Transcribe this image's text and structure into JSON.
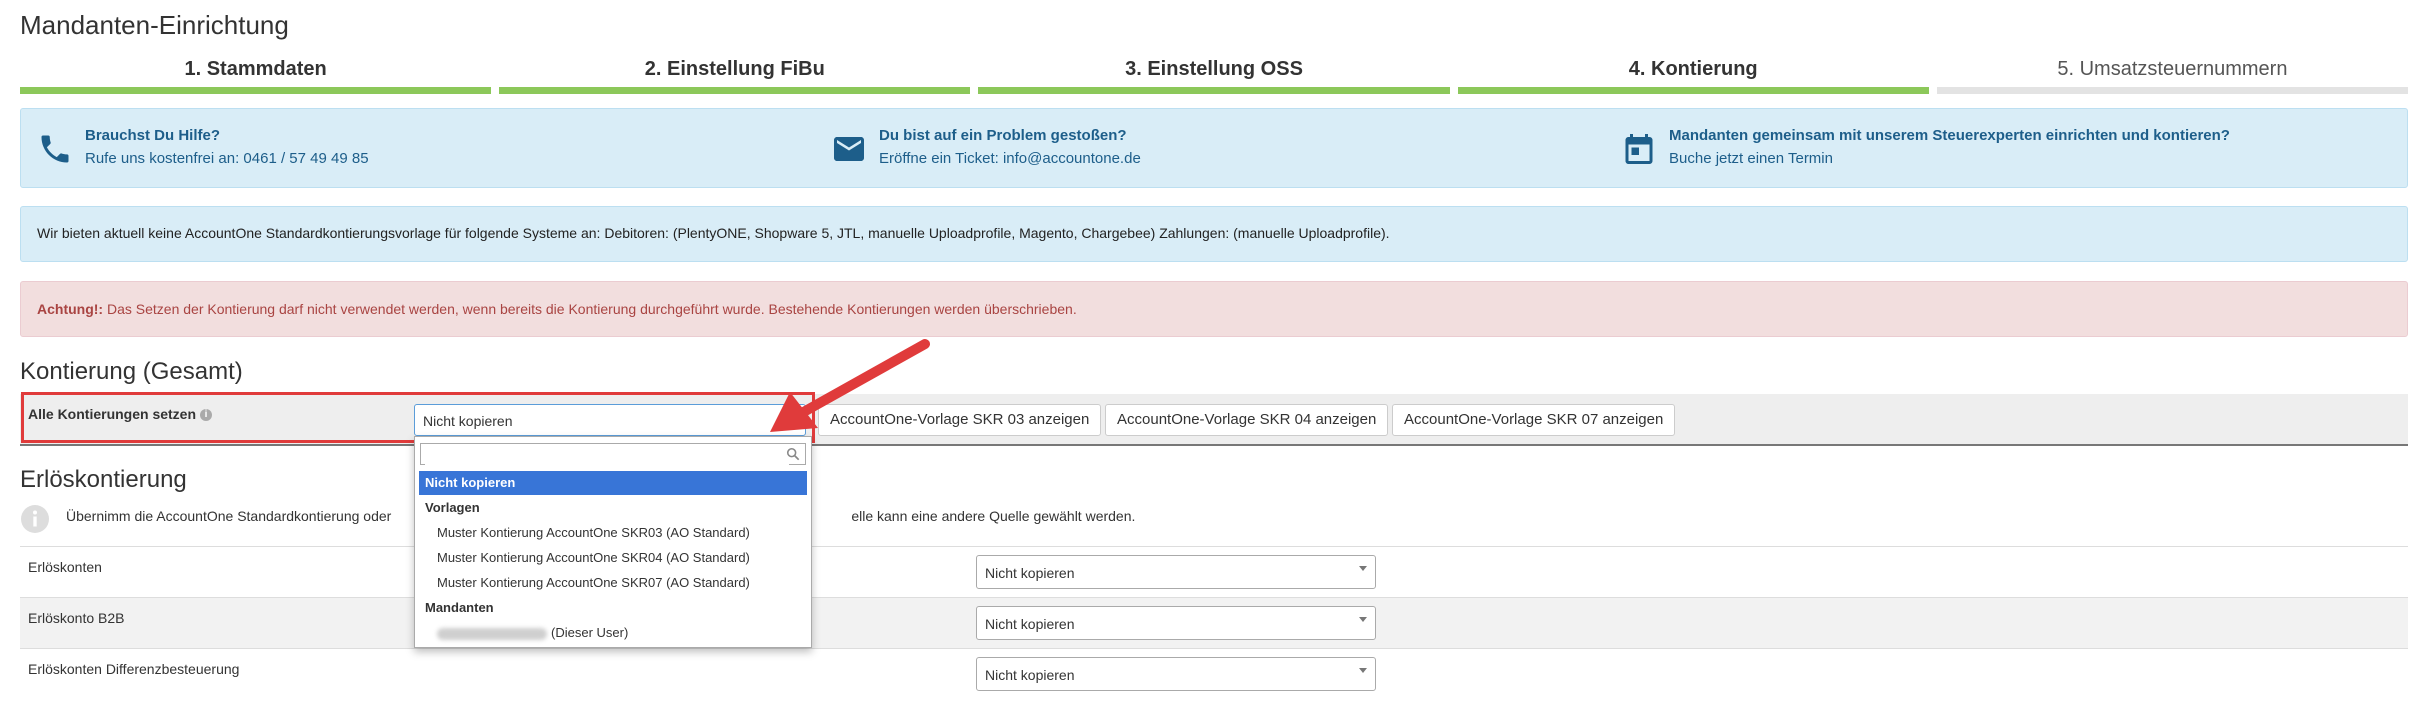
{
  "page": {
    "title": "Mandanten-Einrichtung"
  },
  "steps": [
    {
      "label": "1. Stammdaten",
      "state": "done"
    },
    {
      "label": "2. Einstellung FiBu",
      "state": "done"
    },
    {
      "label": "3. Einstellung OSS",
      "state": "done"
    },
    {
      "label": "4. Kontierung",
      "state": "done"
    },
    {
      "label": "5. Umsatzsteuernummern",
      "state": "pending"
    }
  ],
  "help": [
    {
      "icon": "phone-icon",
      "title": "Brauchst Du Hilfe?",
      "text": "Rufe uns kostenfrei an: 0461 / 57 49 49 85"
    },
    {
      "icon": "mail-icon",
      "title": "Du bist auf ein Problem gestoßen?",
      "text": "Eröffne ein Ticket: info@accountone.de"
    },
    {
      "icon": "calendar-icon",
      "title": "Mandanten gemeinsam mit unserem Steuerexperten einrichten und kontieren?",
      "text": "Buche jetzt einen Termin"
    }
  ],
  "info_notice": "Wir bieten aktuell keine AccountOne Standardkontierungsvorlage für folgende Systeme an: Debitoren: (PlentyONE, Shopware 5, JTL, manuelle Uploadprofile, Magento, Chargebee) Zahlungen: (manuelle Uploadprofile).",
  "warning": {
    "strong": "Achtung!:",
    "text": " Das Setzen der Kontierung darf nicht verwendet werden, wenn bereits die Kontierung durchgeführt wurde. Bestehende Kontierungen werden überschrieben."
  },
  "gesamt": {
    "title": "Kontierung (Gesamt)",
    "label": "Alle Kontierungen setzen",
    "select_value": "Nicht kopieren",
    "buttons": [
      "AccountOne-Vorlage SKR 03 anzeigen",
      "AccountOne-Vorlage SKR 04 anzeigen",
      "AccountOne-Vorlage SKR 07 anzeigen"
    ]
  },
  "dropdown": {
    "search_placeholder": "",
    "highlighted": "Nicht kopieren",
    "group_vorlagen": "Vorlagen",
    "vorlagen": [
      "Muster Kontierung AccountOne SKR03 (AO Standard)",
      "Muster Kontierung AccountOne SKR04 (AO Standard)",
      "Muster Kontierung AccountOne SKR07 (AO Standard)"
    ],
    "group_mandanten": "Mandanten",
    "mandant_suffix": "(Dieser User)"
  },
  "erloes": {
    "title": "Erlöskontierung",
    "info_left": "Übernimm die AccountOne Standardkontierung oder",
    "info_right": "elle kann eine andere Quelle gewählt werden.",
    "rows": [
      {
        "label": "Erlöskonten",
        "value": "Nicht kopieren"
      },
      {
        "label": "Erlöskonto B2B",
        "value": "Nicht kopieren"
      },
      {
        "label": "Erlöskonten Differenzbesteuerung",
        "value": "Nicht kopieren"
      }
    ]
  },
  "colors": {
    "step_done": "#8cc85a",
    "step_pending": "#e3e3e3",
    "info_bg": "#d9edf7",
    "danger_bg": "#f2dede",
    "danger_text": "#a94442",
    "highlight": "#3875d7",
    "annotation_red": "#e03b3b"
  }
}
